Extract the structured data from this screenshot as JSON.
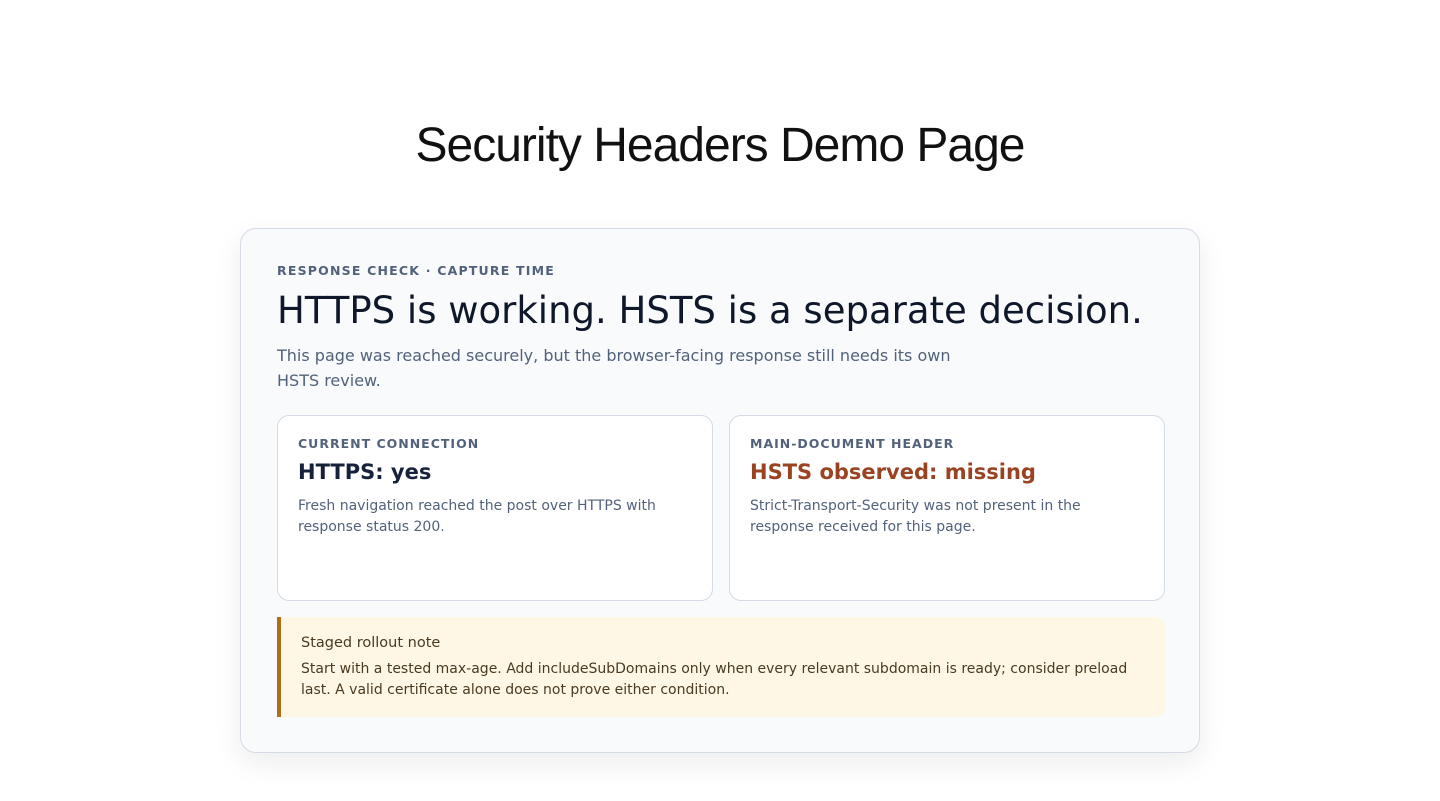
{
  "page": {
    "title": "Security Headers Demo Page"
  },
  "card": {
    "eyebrow": "RESPONSE CHECK · CAPTURE TIME",
    "headline": "HTTPS is working. HSTS is a separate decision.",
    "lead": "This page was reached securely, but the browser-facing response still needs its own HSTS review."
  },
  "panels": [
    {
      "label": "CURRENT CONNECTION",
      "value": "HTTPS: yes",
      "description": "Fresh navigation reached the post over HTTPS with response status 200."
    },
    {
      "label": "MAIN-DOCUMENT HEADER",
      "value": "HSTS observed: missing",
      "description": "Strict-Transport-Security was not present in the response received for this page."
    }
  ],
  "note": {
    "title": "Staged rollout note",
    "body": "Start with a tested max-age. Add includeSubDomains only when every relevant subdomain is ready; consider preload last. A valid certificate alone does not prove either condition."
  },
  "colors": {
    "warning_text": "#9a4323",
    "note_accent": "#b06e15",
    "note_background": "#fff7e6"
  }
}
